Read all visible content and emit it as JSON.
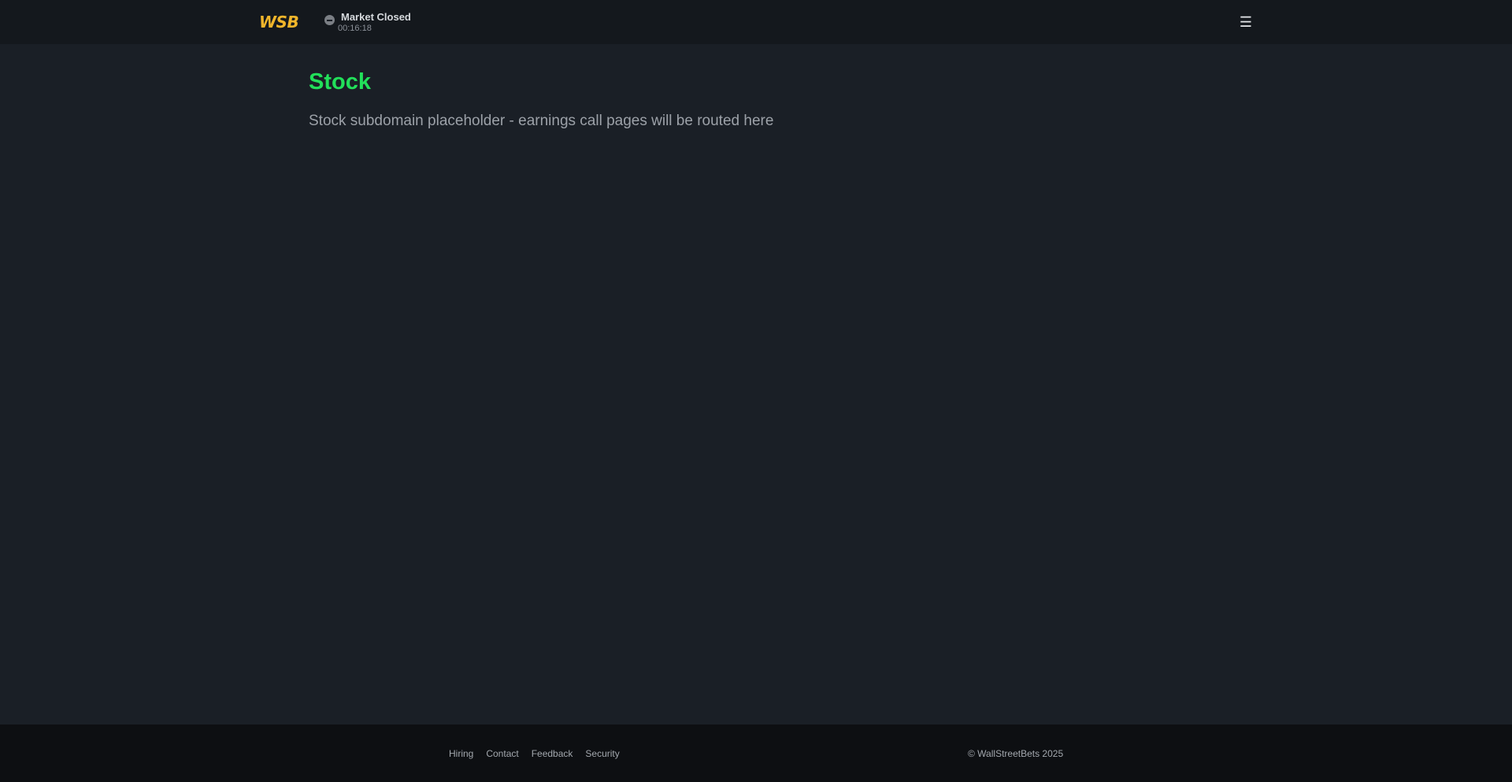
{
  "header": {
    "logo": "WSB",
    "market_status": {
      "label": "Market Closed",
      "time": "00:16:18",
      "icon": "minus-circle-icon"
    },
    "menu_icon": "☰"
  },
  "main": {
    "title": "Stock",
    "subtitle": "Stock subdomain placeholder - earnings call pages will be routed here"
  },
  "footer": {
    "links": [
      "Hiring",
      "Contact",
      "Feedback",
      "Security"
    ],
    "copyright": "© WallStreetBets 2025"
  },
  "colors": {
    "brand": "#f0b52b",
    "accent": "#22e05a",
    "background": "#1a1f26",
    "header_background": "#14181d",
    "footer_background": "#0d0f12"
  }
}
